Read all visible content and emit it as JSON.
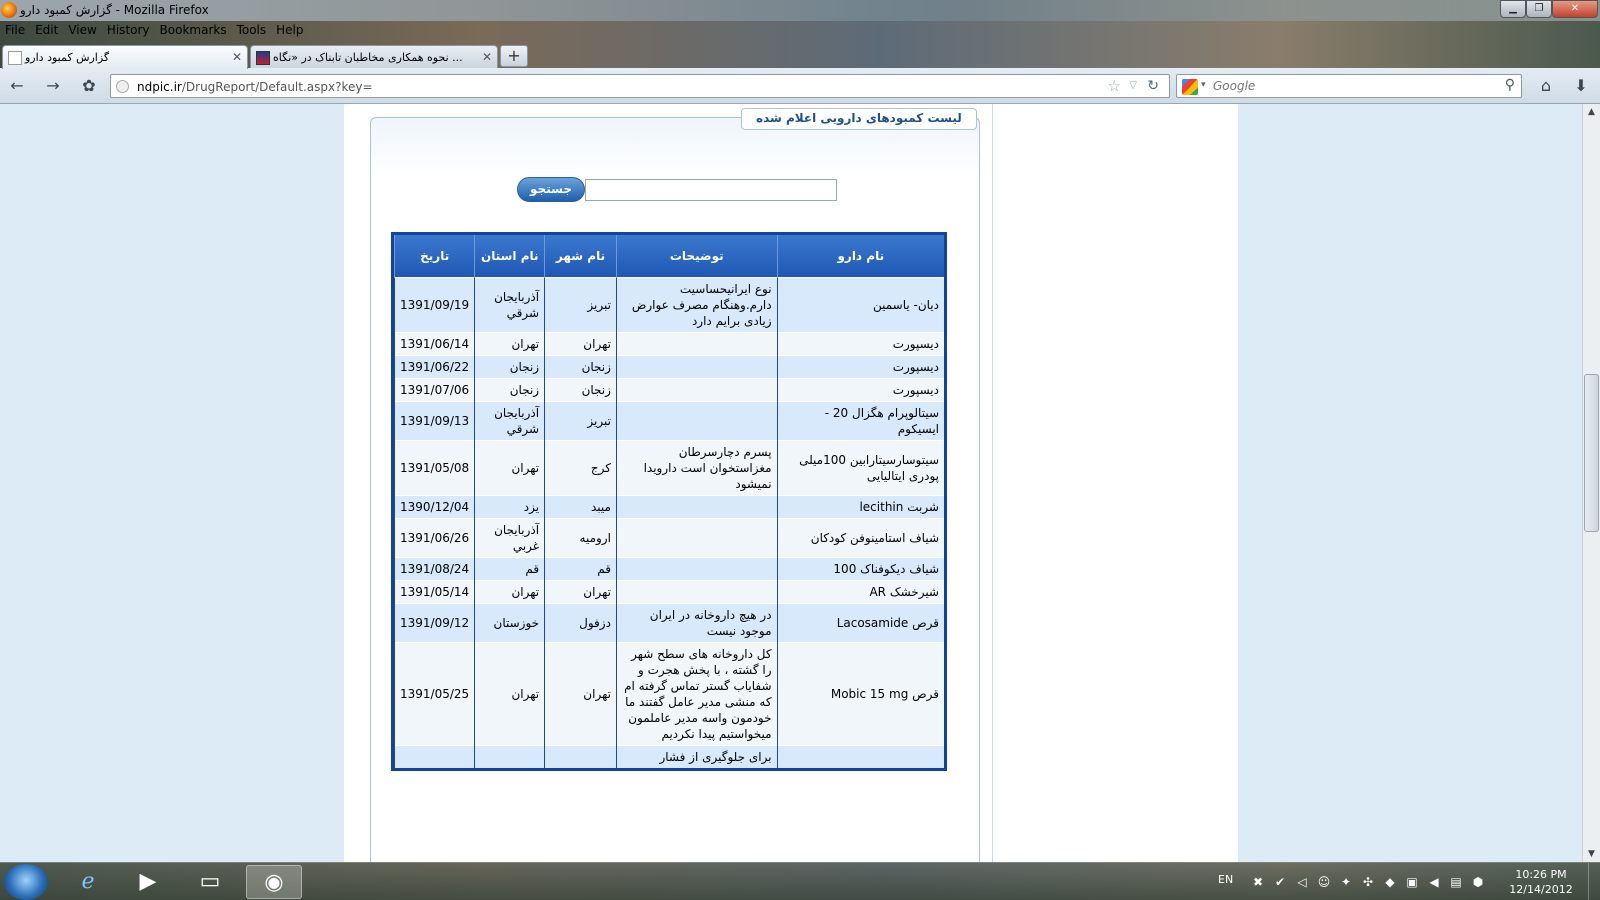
{
  "window": {
    "title": "گزارش کمبود دارو - Mozilla Firefox"
  },
  "menu": [
    "File",
    "Edit",
    "View",
    "History",
    "Bookmarks",
    "Tools",
    "Help"
  ],
  "tabs": [
    {
      "label": "گزارش کمبود دارو"
    },
    {
      "label": "نحوه همکاری مخاطبان تابناک در «نگاه ..."
    }
  ],
  "url": {
    "host": "ndpic.ir",
    "path": "/DrugReport/Default.aspx?key="
  },
  "search": {
    "placeholder": "Google"
  },
  "page": {
    "legend": "ليست كمبودهای دارويی اعلام شده",
    "search_button": "جستجو",
    "search_value": ""
  },
  "table": {
    "headers": [
      "نام دارو",
      "توضيحات",
      "نام شهر",
      "نام استان",
      "تاریخ"
    ],
    "rows": [
      {
        "drug": "دیان- یاسمین",
        "desc": "نوع ایرانیحساسیت دارم.وهنگام مصرف عوارض زیادی برایم دارد",
        "city": "تبريز",
        "province": "آذربايجان شرقي",
        "date": "1391/09/19"
      },
      {
        "drug": "دیسپورت",
        "desc": "",
        "city": "تهران",
        "province": "تهران",
        "date": "1391/06/14"
      },
      {
        "drug": "دیسپورت",
        "desc": "",
        "city": "زنجان",
        "province": "زنجان",
        "date": "1391/06/22"
      },
      {
        "drug": "دیسپورت",
        "desc": "",
        "city": "زنجان",
        "province": "زنجان",
        "date": "1391/07/06"
      },
      {
        "drug": "سیتالوپرام هگزال 20 - ایسیکوم",
        "desc": "",
        "city": "تبريز",
        "province": "آذربايجان شرقي",
        "date": "1391/09/13"
      },
      {
        "drug": "سیتوسارسیتارابین 100میلی پودری ایتالیایی",
        "desc": "پسرم دچارسرطان مغزاستخوان است دارویدا نمیشود",
        "city": "كرج",
        "province": "تهران",
        "date": "1391/05/08"
      },
      {
        "drug": "شربت lecithin",
        "desc": "",
        "city": "ميبد",
        "province": "يزد",
        "date": "1390/12/04"
      },
      {
        "drug": "شیاف استامینوفن کودکان",
        "desc": "",
        "city": "اروميه",
        "province": "آذربايجان غربي",
        "date": "1391/06/26"
      },
      {
        "drug": "شیاف دیکوفناک 100",
        "desc": "",
        "city": "قم",
        "province": "قم",
        "date": "1391/08/24"
      },
      {
        "drug": "شیرخشک AR",
        "desc": "",
        "city": "تهران",
        "province": "تهران",
        "date": "1391/05/14"
      },
      {
        "drug": "قرص Lacosamide",
        "desc": "در هیچ داروخانه در ایران موجود نیست",
        "city": "دزفول",
        "province": "خوزستان",
        "date": "1391/09/12"
      },
      {
        "drug": "قرص Mobic 15 mg",
        "desc": "کل داروخانه های سطح شهر را گشته ، با پخش هجرت و شفایاب گستر تماس گرفته ام که منشی مدیر عامل گفتند ما خودمون واسه مدیر عاملمون میخواستیم پیدا نکردیم",
        "city": "تهران",
        "province": "تهران",
        "date": "1391/05/25"
      },
      {
        "drug": "",
        "desc": "برای جلوگیری از فشار",
        "city": "",
        "province": "",
        "date": ""
      }
    ]
  },
  "taskbar": {
    "lang": "EN",
    "time": "10:26 PM",
    "date": "12/14/2012"
  }
}
